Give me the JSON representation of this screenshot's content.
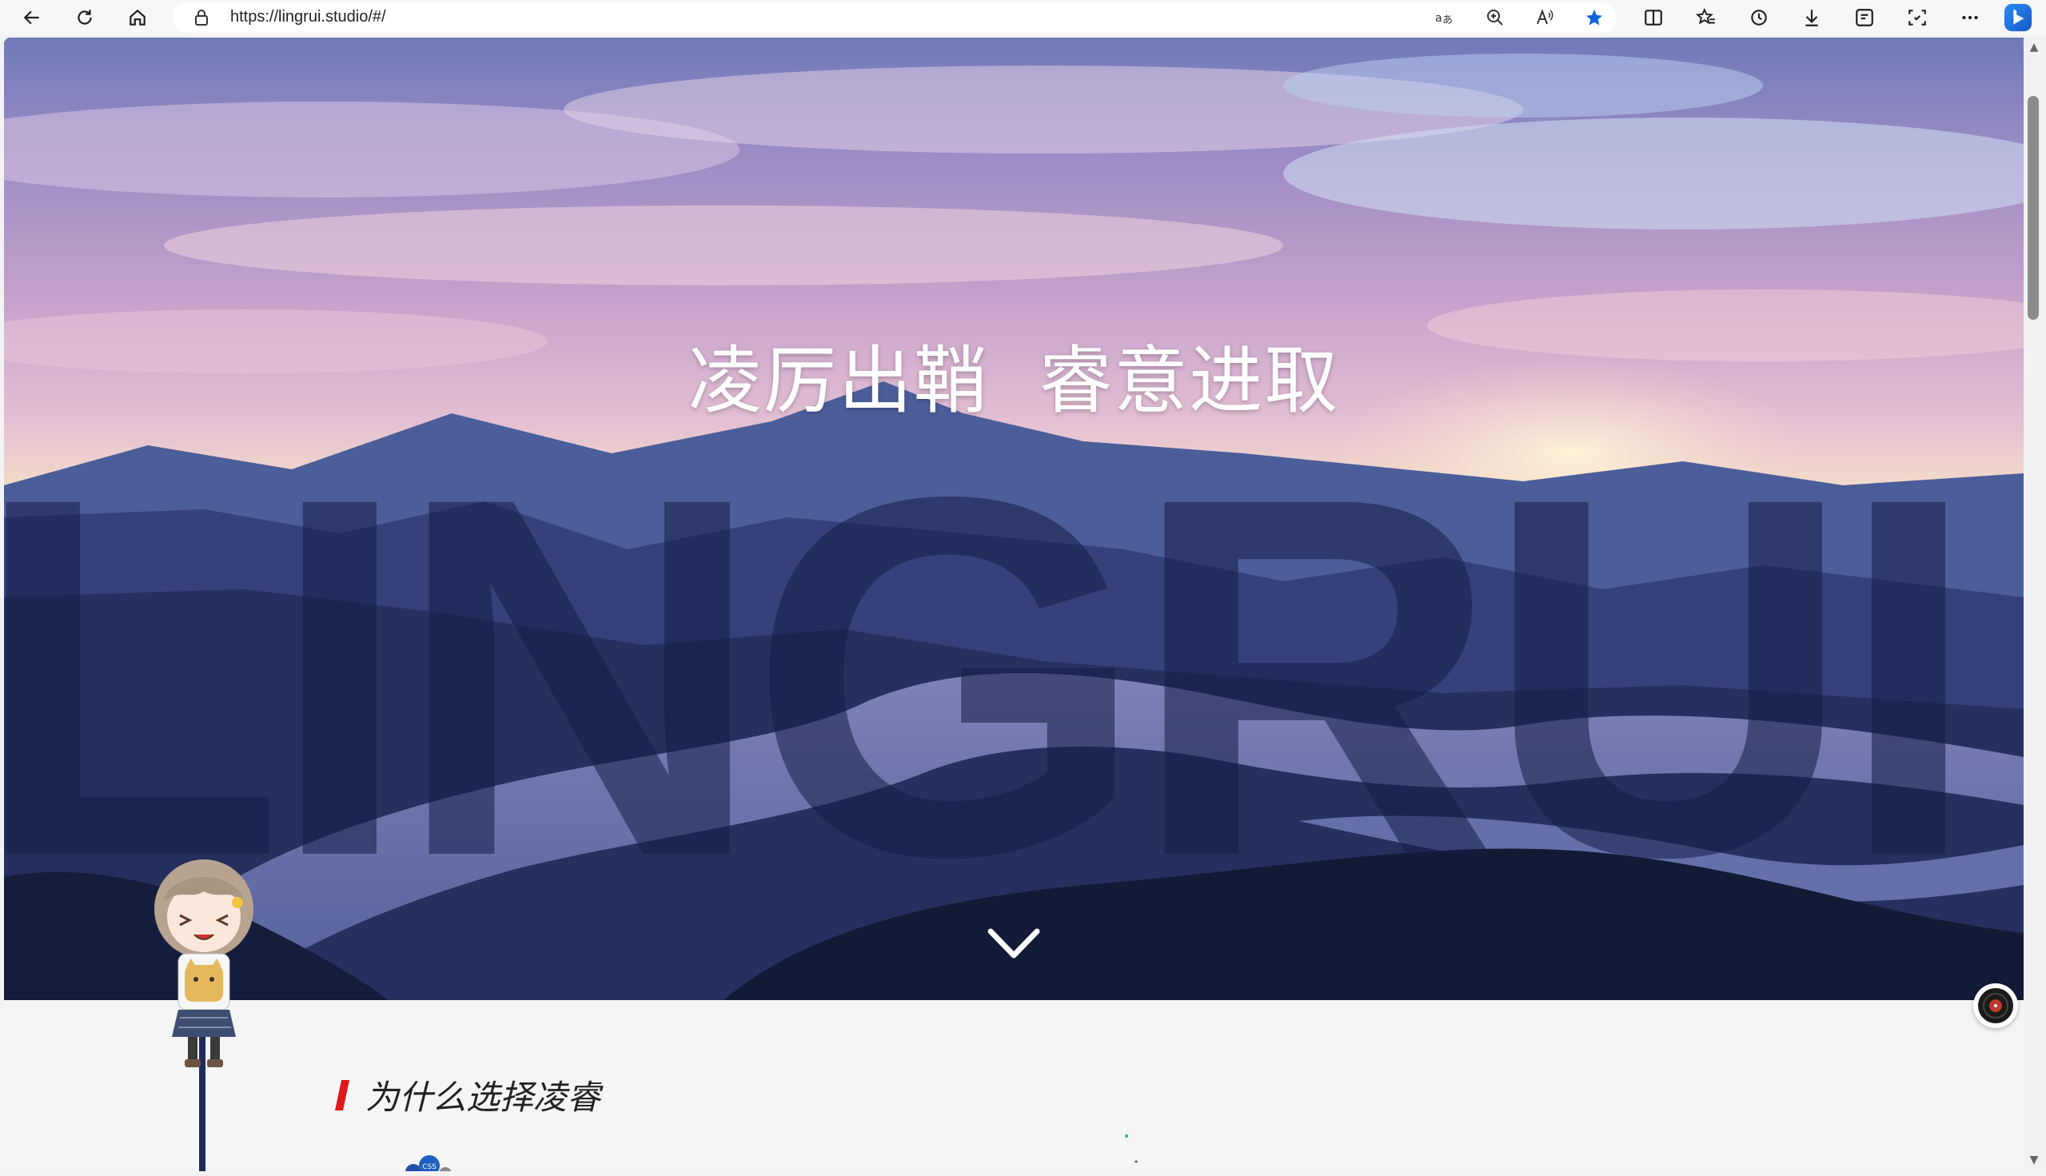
{
  "browser": {
    "url": "https://lingrui.studio/#/"
  },
  "hero": {
    "slogan": "凌厉出鞘  睿意进取",
    "big_word": "LINGRUI"
  },
  "section": {
    "title": "为什么选择凌睿"
  },
  "skill_badge": "CSS",
  "colors": {
    "accent_red": "#e01818",
    "favorite_star": "#0a64d6"
  }
}
